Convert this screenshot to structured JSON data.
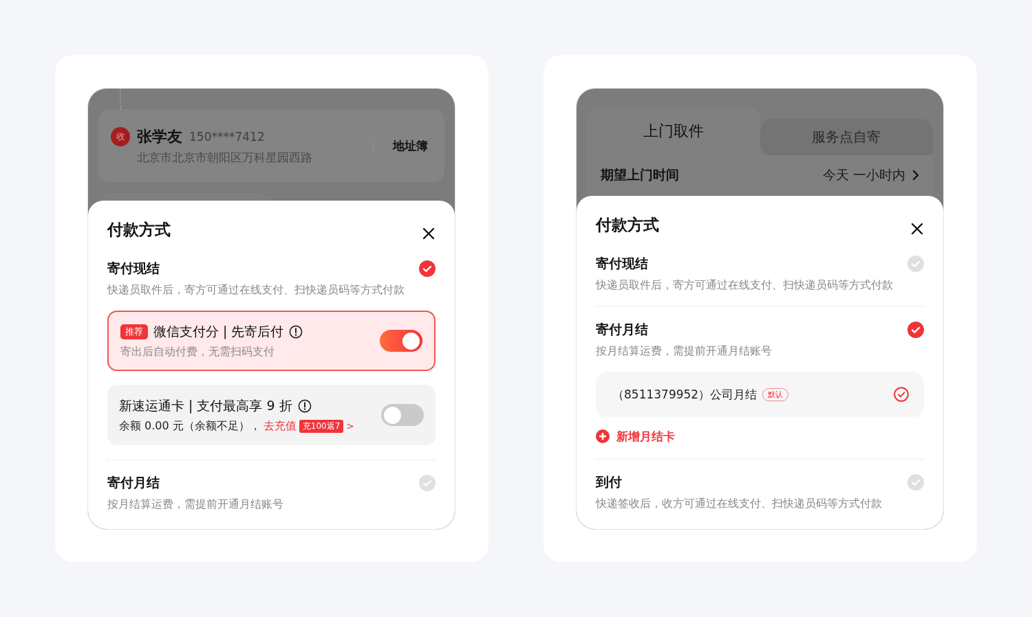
{
  "panels": [
    {
      "background": {
        "kind": "address",
        "badge": "收",
        "name": "张学友",
        "phone": "150****7412",
        "address": "北京市北京市朝阳区万科星园西路",
        "action": "地址簿"
      },
      "sheet": {
        "title": "付款方式",
        "options": [
          {
            "title": "寄付现结",
            "description": "快递员取件后，寄方可通过在线支付、扫快递员码等方式付款",
            "selected": true,
            "methods": [
              {
                "badge": "推荐",
                "title": "微信支付分 | 先寄后付",
                "description": "寄出后自动付费，无需扫码支付",
                "on": true
              },
              {
                "title": "新速运通卡 | 支付最高享 9 折",
                "balance": "余额 0.00 元（余额不足），",
                "link": "去充值",
                "promo": "充100返7",
                "arrow": ">",
                "on": false
              }
            ]
          },
          {
            "title": "寄付月结",
            "description": "按月结算运费，需提前开通月结账号",
            "selected": false
          }
        ]
      }
    },
    {
      "background": {
        "kind": "tabs",
        "tabs": [
          {
            "label": "上门取件",
            "selected": true
          },
          {
            "label": "服务点自寄",
            "selected": false
          }
        ],
        "row": {
          "label": "期望上门时间",
          "value": "今天 一小时内"
        }
      },
      "sheet": {
        "title": "付款方式",
        "options": [
          {
            "title": "寄付现结",
            "description": "快递员取件后，寄方可通过在线支付、扫快递员码等方式付款",
            "selected": false
          },
          {
            "title": "寄付月结",
            "description": "按月结算运费，需提前开通月结账号",
            "selected": true,
            "accounts": [
              {
                "label": "（8511379952）公司月结",
                "tag": "默认",
                "selected": true
              }
            ],
            "add": "新增月结卡"
          },
          {
            "title": "到付",
            "description": "快递签收后，收方可通过在线支付、扫快递员码等方式付款",
            "selected": false
          }
        ]
      }
    }
  ]
}
